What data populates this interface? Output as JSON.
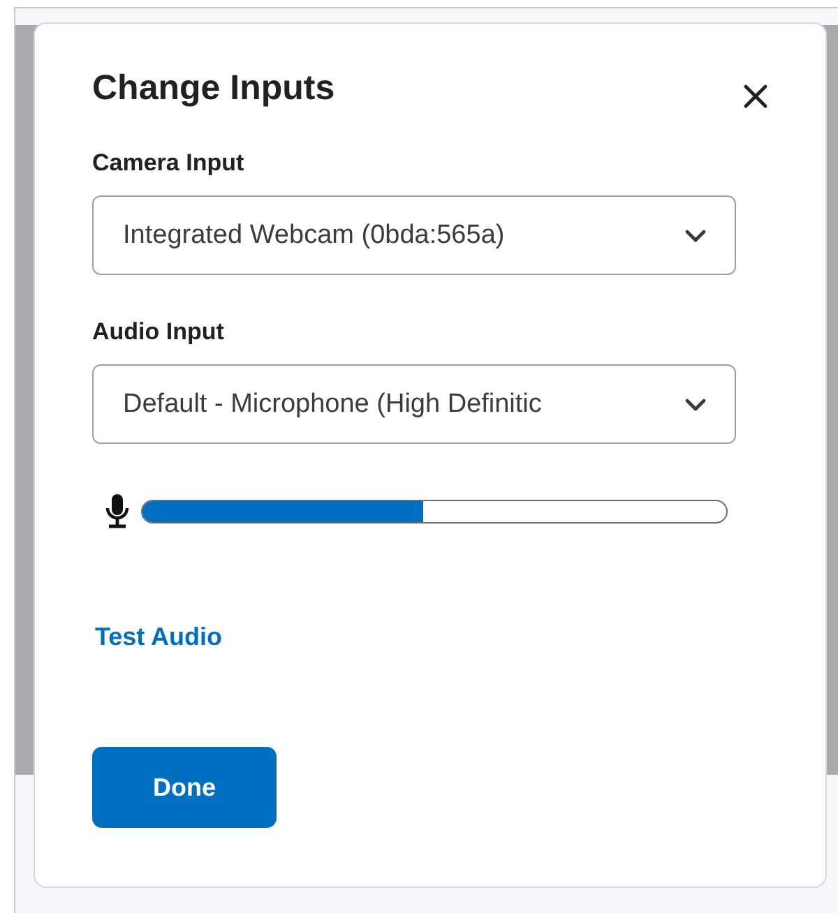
{
  "dialog": {
    "title": "Change Inputs",
    "fields": [
      {
        "label": "Camera Input",
        "value": "Integrated Webcam (0bda:565a)"
      },
      {
        "label": "Audio Input",
        "value": "Default - Microphone (High Definitic"
      }
    ],
    "meter": {
      "level": 0.48
    },
    "link": "Test Audio",
    "buttons": [
      "Done"
    ]
  }
}
